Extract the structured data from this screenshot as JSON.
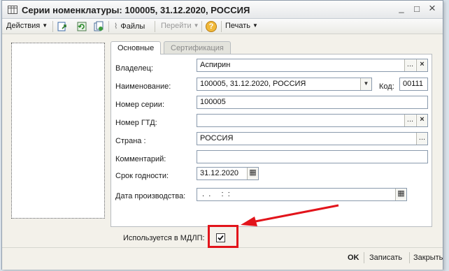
{
  "window": {
    "title": "Серии номенклатуры: 100005, 31.12.2020, РОССИЯ",
    "controls": {
      "minimize": "_",
      "maximize": "□",
      "close": "×"
    }
  },
  "toolbar": {
    "actions_label": "Действия",
    "files_label": "Файлы",
    "goto_label": "Перейти",
    "help_label": "?",
    "print_label": "Печать"
  },
  "tabs": [
    {
      "label": "Основные",
      "active": true
    },
    {
      "label": "Сертификация",
      "active": false
    }
  ],
  "form": {
    "owner": {
      "label": "Владелец:",
      "value": "Аспирин"
    },
    "name": {
      "label": "Наименование:",
      "value": "100005, 31.12.2020, РОССИЯ"
    },
    "code": {
      "label": "Код:",
      "value": "00111"
    },
    "series_number": {
      "label": "Номер серии:",
      "value": "100005"
    },
    "gtd_number": {
      "label": "Номер ГТД:",
      "value": ""
    },
    "country": {
      "label": "Страна :",
      "value": "РОССИЯ"
    },
    "comment": {
      "label": "Комментарий:",
      "value": ""
    },
    "expiry": {
      "label": "Срок годности:",
      "value": "31.12.2020"
    },
    "production_date": {
      "label": "Дата производства:",
      "value": " .  .     :  :"
    },
    "mdlp": {
      "label": "Используется в МДЛП:",
      "checked": true
    }
  },
  "footer": {
    "ok_label": "OK",
    "save_label": "Записать",
    "close_label": "Закрыть"
  },
  "colors": {
    "annotation_red": "#e2141b",
    "field_border": "#8a9aad",
    "window_bg": "#f3f1ea"
  }
}
